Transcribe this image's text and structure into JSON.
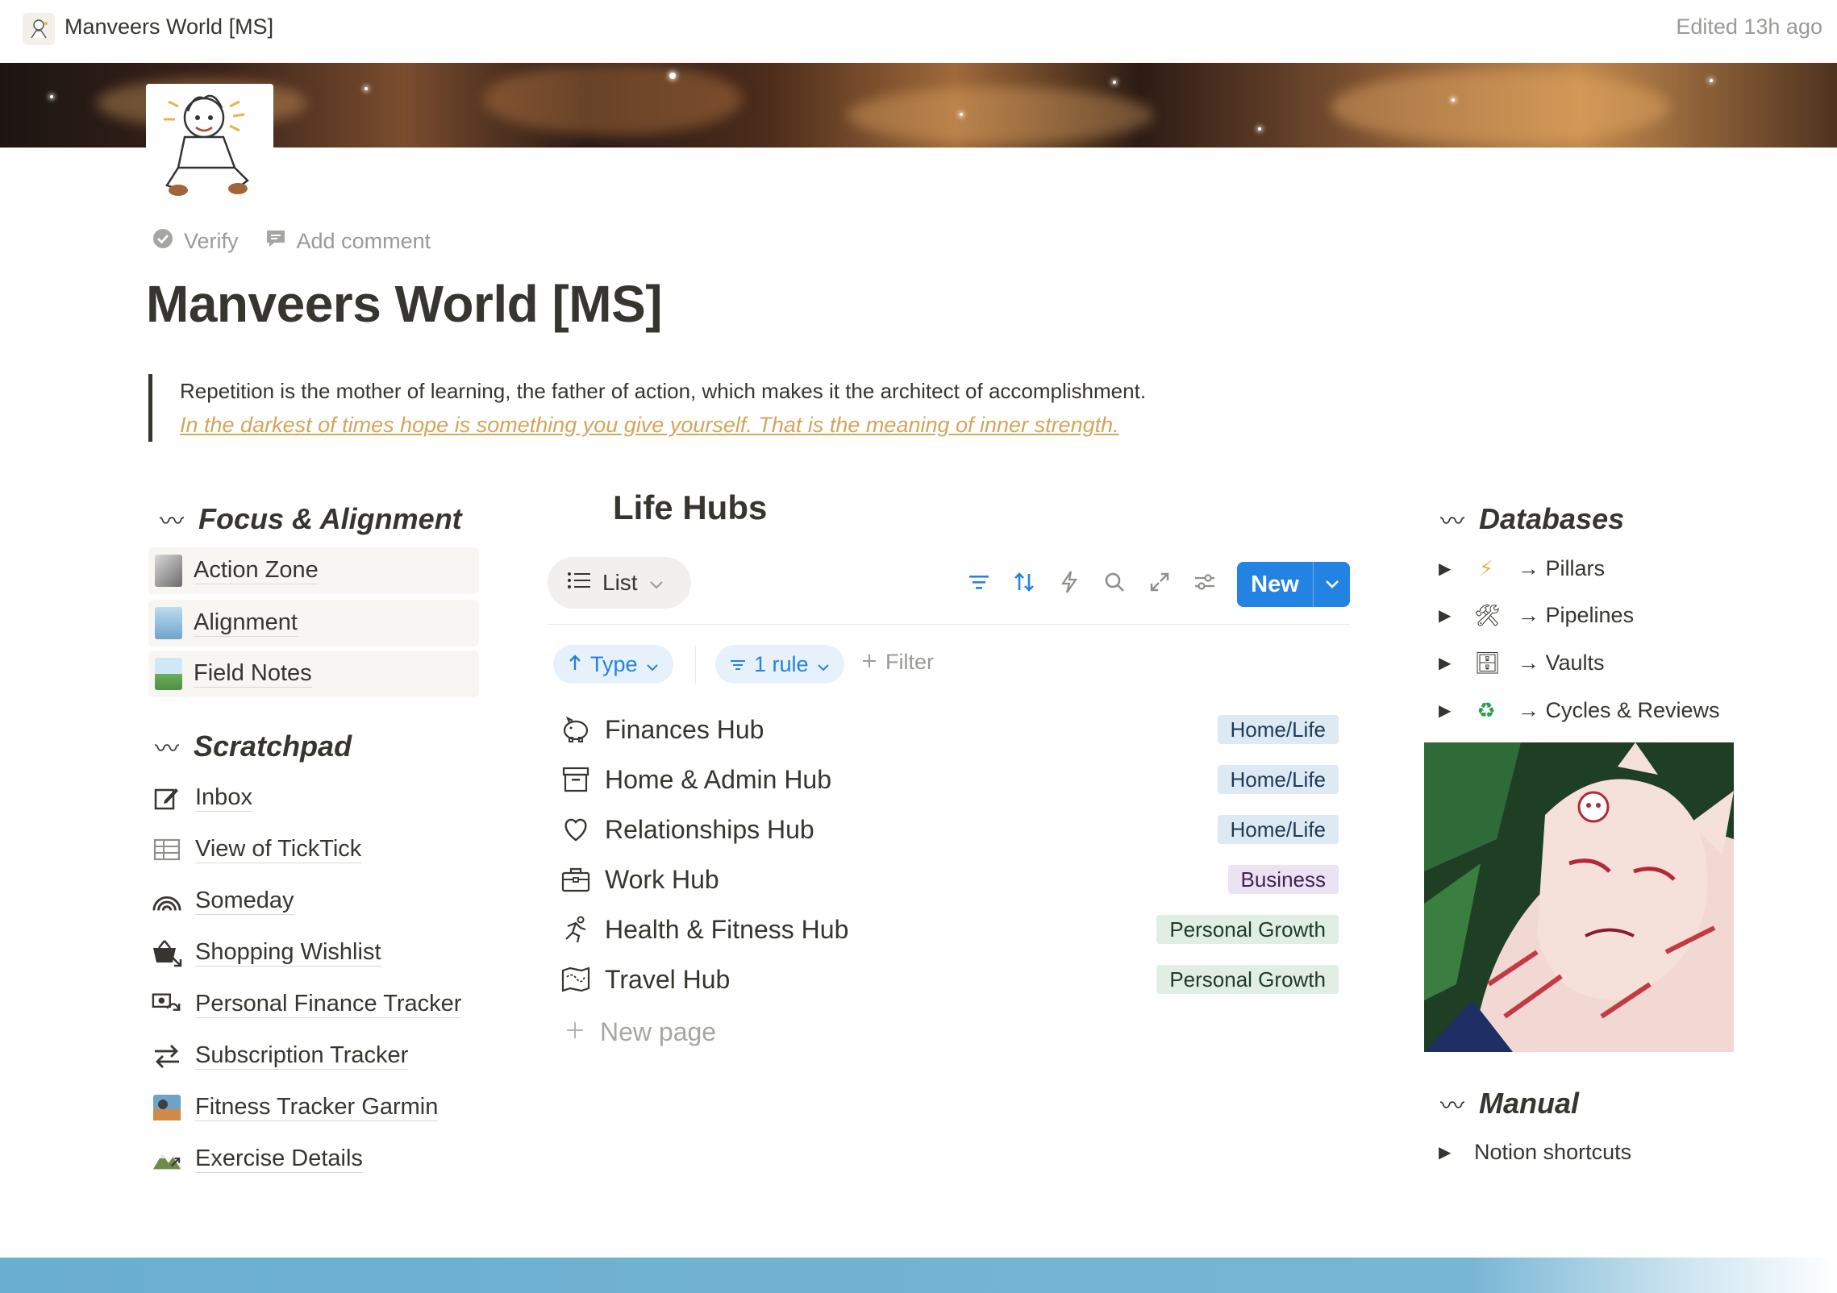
{
  "topbar": {
    "title": "Manveers World [MS]",
    "edited": "Edited 13h ago",
    "icon": "character-avatar-icon"
  },
  "page_actions": {
    "verify": "Verify",
    "comment": "Add comment"
  },
  "page": {
    "title": "Manveers World [MS]",
    "quote_line1": "Repetition is the mother of learning, the father of action, which makes it the architect of accomplishment.",
    "quote_line2": "In the darkest of times hope is something you give yourself. That is the meaning of inner strength."
  },
  "focus": {
    "heading": "Focus & Alignment",
    "items": [
      {
        "label": "Action Zone"
      },
      {
        "label": "Alignment"
      },
      {
        "label": "Field Notes"
      }
    ]
  },
  "scratchpad": {
    "heading": "Scratchpad",
    "items": [
      {
        "label": "Inbox",
        "icon": "edit-icon"
      },
      {
        "label": "View of TickTick",
        "icon": "table-icon"
      },
      {
        "label": "Someday",
        "icon": "rainbow-icon"
      },
      {
        "label": "Shopping Wishlist",
        "icon": "basket-icon"
      },
      {
        "label": "Personal Finance Tracker",
        "icon": "money-exchange-icon"
      },
      {
        "label": "Subscription Tracker",
        "icon": "repeat-icon"
      },
      {
        "label": "Fitness Tracker Garmin",
        "icon": "photo-thumbnail-icon"
      },
      {
        "label": "Exercise Details",
        "icon": "mountain-icon"
      }
    ]
  },
  "life_hubs": {
    "title": "Life Hubs",
    "view_label": "List",
    "new_label": "New",
    "chips": {
      "type": "Type",
      "rule": "1 rule",
      "filter": "Filter"
    },
    "rows": [
      {
        "name": "Finances Hub",
        "tag": "Home/Life",
        "icon": "piggy-bank-icon"
      },
      {
        "name": "Home & Admin Hub",
        "tag": "Home/Life",
        "icon": "archive-icon"
      },
      {
        "name": "Relationships Hub",
        "tag": "Home/Life",
        "icon": "heart-icon"
      },
      {
        "name": "Work Hub",
        "tag": "Business",
        "icon": "briefcase-icon"
      },
      {
        "name": "Health & Fitness Hub",
        "tag": "Personal Growth",
        "icon": "running-icon"
      },
      {
        "name": "Travel Hub",
        "tag": "Personal Growth",
        "icon": "map-icon"
      }
    ],
    "new_page": "New page"
  },
  "databases": {
    "heading": "Databases",
    "items": [
      {
        "emoji": "⚡",
        "label": "→ Pillars"
      },
      {
        "emoji": "🛠",
        "label": "→ Pipelines"
      },
      {
        "emoji": "🗄",
        "label": "→ Vaults"
      },
      {
        "emoji": "♻",
        "label": "→ Cycles & Reviews"
      }
    ]
  },
  "manual": {
    "heading": "Manual",
    "items": [
      {
        "label": "Notion shortcuts"
      }
    ]
  },
  "colors": {
    "accent": "#2383e2",
    "quote_gold": "#d4a55b",
    "text": "#37352f"
  }
}
